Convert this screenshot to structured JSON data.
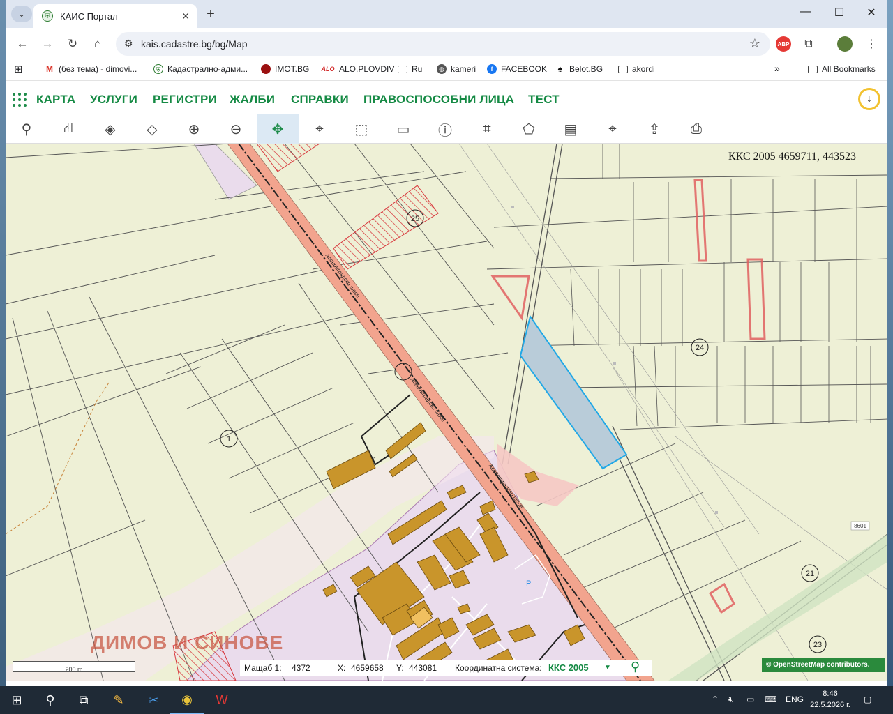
{
  "browser": {
    "tab_title": "КАИС Портал",
    "new_tab_symbol": "+",
    "url": "kais.cadastre.bg/bg/Map",
    "window_controls": [
      "—",
      "☐",
      "✕"
    ],
    "extensions": [
      "ABP"
    ]
  },
  "bookmarks": [
    {
      "label": "(без тема) - dimovi...",
      "icon": "gmail-icon"
    },
    {
      "label": "Кадастрално-адми...",
      "icon": "cadastre-icon"
    },
    {
      "label": "IMOT.BG",
      "icon": "imot-icon"
    },
    {
      "label": "ALO.PLOVDIV",
      "icon": "alo-icon",
      "icon_text": "ALO"
    },
    {
      "label": "Ru",
      "icon": "folder-icon"
    },
    {
      "label": "kameri",
      "icon": "globe-icon"
    },
    {
      "label": "FACEBOOK",
      "icon": "facebook-icon"
    },
    {
      "label": "Belot.BG",
      "icon": "spade-icon"
    },
    {
      "label": "akordi",
      "icon": "folder-icon"
    }
  ],
  "all_bookmarks": "All Bookmarks",
  "app_nav": [
    "КАРТА",
    "УСЛУГИ",
    "РЕГИСТРИ",
    "ЖАЛБИ",
    "СПРАВКИ",
    "ПРАВОСПОСОБНИ ЛИЦА",
    "ТЕСТ"
  ],
  "map_tools": [
    {
      "name": "search-tool",
      "glyph": "⚲"
    },
    {
      "name": "route-tool",
      "glyph": "⛙"
    },
    {
      "name": "layers-tool",
      "glyph": "◈"
    },
    {
      "name": "layers-outline-tool",
      "glyph": "◇"
    },
    {
      "name": "zoom-in-tool",
      "glyph": "⊕"
    },
    {
      "name": "zoom-out-tool",
      "glyph": "⊖"
    },
    {
      "name": "pan-tool",
      "glyph": "✥"
    },
    {
      "name": "marker-tool",
      "glyph": "⌖"
    },
    {
      "name": "select-rect-tool",
      "glyph": "⬚"
    },
    {
      "name": "deselect-rect-tool",
      "glyph": "▭"
    },
    {
      "name": "info-tool",
      "glyph": "ⓘ"
    },
    {
      "name": "measure-tool",
      "glyph": "⌗"
    },
    {
      "name": "polygon-tool",
      "glyph": "⬠"
    },
    {
      "name": "map-tool",
      "glyph": "▤"
    },
    {
      "name": "coordinate-tool",
      "glyph": "⌖"
    },
    {
      "name": "export-tool",
      "glyph": "⇪"
    },
    {
      "name": "print-tool",
      "glyph": "⎙"
    }
  ],
  "map": {
    "coords_top": "ККС 2005 4659711, 443523",
    "watermark": "ДИМОВ И СИНОВЕ",
    "scale_label": "200 m",
    "info": {
      "scale_label": "Мащаб 1:",
      "scale_value": "4372",
      "x_label": "X:",
      "x_value": "4659658",
      "y_label": "Y:",
      "y_value": "443081",
      "cs_label": "Координатна система:",
      "cs_value": "ККС 2005"
    },
    "osm": "© OpenStreetMap contributors.",
    "labels": [
      "25",
      "24",
      "1",
      "21",
      "23",
      "P"
    ],
    "road_label": "Асеновградско шосе",
    "badge_label": "8601",
    "colors": {
      "road": "#f2a48e",
      "parcel": "#eef0d6",
      "industrial": "#eadcec",
      "building": "#c9952b",
      "selected": "#b9ccd9",
      "selected_border": "#22a8e6",
      "hatch": "#d8363b"
    }
  },
  "taskbar": {
    "lang": "ENG",
    "time": "8:46",
    "date": "22.5.2026 г."
  }
}
